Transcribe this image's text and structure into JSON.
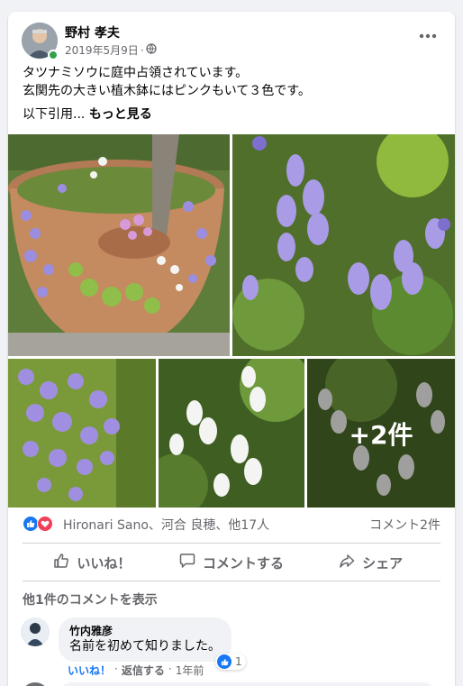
{
  "post": {
    "author": "野村 孝夫",
    "date": "2019年5月9日",
    "date_separator": "·",
    "text_line1": "タツナミソウに庭中占領されています。",
    "text_line2": "玄関先の大きい植木鉢にはピンクもいて３色です。",
    "text_line3": "以下引用...",
    "see_more": "もっと見る"
  },
  "photos": {
    "more_overlay": "+2件"
  },
  "reactions": {
    "names": "Hironari Sano、河合 良穂、他17人",
    "comment_count": "コメント2件"
  },
  "actions": {
    "like": "いいね！",
    "comment": "コメントする",
    "share": "シェア"
  },
  "comments": {
    "view_more": "他1件のコメントを表示",
    "items": [
      {
        "name": "竹内雅彦",
        "text": "名前を初めて知りました。",
        "like_action": "いいね！",
        "reply_action": "返信する",
        "time": "1年前",
        "likes": "1"
      }
    ]
  },
  "colors": {
    "accent": "#1877f2",
    "love": "#f33e58",
    "online": "#31a24c",
    "flower_purple": "#9b8ee0",
    "flower_white": "#f4f5f2",
    "leaf_green": "#6f9a3c"
  },
  "icons": [
    "globe-icon",
    "more-dots-icon",
    "like-reaction-icon",
    "love-reaction-icon",
    "thumbs-up-icon",
    "comment-icon",
    "share-icon"
  ]
}
